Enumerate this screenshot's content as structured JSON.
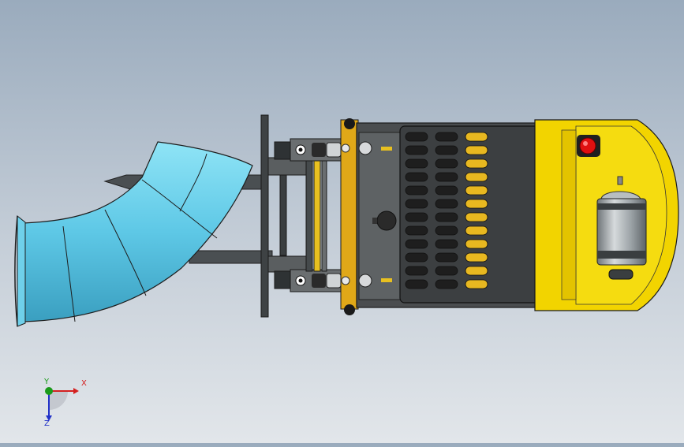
{
  "viewport": {
    "background_top": "#9aabbd",
    "background_bottom": "#e2e6ea"
  },
  "model": {
    "colors": {
      "duct": "#5ec8e6",
      "duct_shadow": "#3a9fc0",
      "body_yellow": "#f2d400",
      "frame_dark": "#3a3a3a",
      "frame_mid": "#5a5a5a",
      "slot_yellow": "#e8b820",
      "warning_red": "#e01010",
      "motor_silver": "#a9b0b4"
    },
    "icons": [
      "red-indicator-icon",
      "motor-canister-icon",
      "fan-hub-icon"
    ]
  },
  "triad": {
    "x_label": "X",
    "y_label": "Y",
    "z_label": "Z",
    "x_color": "#d42020",
    "y_color": "#1a9a1a",
    "z_color": "#2030c8"
  }
}
